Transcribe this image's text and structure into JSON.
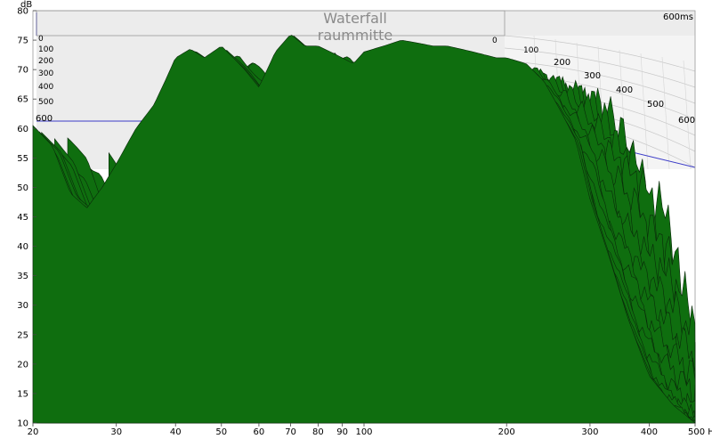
{
  "chart_data": {
    "type": "area",
    "title": "Waterfall",
    "subtitle": "raummitte",
    "ylabel": "dB",
    "xunit": "Hz",
    "xscale": "log",
    "xlim": [
      20,
      500
    ],
    "ylim": [
      10,
      80
    ],
    "x_ticks": [
      "20",
      "30",
      "40",
      "50",
      "60",
      "70",
      "80",
      "90",
      "100",
      "200",
      "300",
      "400",
      "500 Hz"
    ],
    "y_ticks": [
      "10",
      "15",
      "20",
      "25",
      "30",
      "35",
      "40",
      "45",
      "50",
      "55",
      "60",
      "65",
      "70",
      "75",
      "80"
    ],
    "time_axis_label": "600ms",
    "time_ticks_left": [
      "0",
      "100",
      "200",
      "300",
      "400",
      "500",
      "600"
    ],
    "time_ticks_right": [
      "0",
      "100",
      "200",
      "300",
      "400",
      "500",
      "600"
    ],
    "grid": true,
    "front_slice": {
      "time_ms": 0,
      "x": [
        20,
        22,
        24,
        26,
        28,
        30,
        33,
        36,
        38,
        40,
        43,
        46,
        50,
        53,
        56,
        60,
        65,
        70,
        75,
        80,
        85,
        90,
        95,
        100,
        110,
        120,
        130,
        140,
        150,
        160,
        170,
        180,
        190,
        200,
        220,
        240,
        260,
        280,
        300,
        330,
        360,
        400,
        450,
        500
      ],
      "y": [
        60.5,
        57,
        49,
        46.5,
        50,
        54,
        60,
        64,
        68,
        72,
        73.5,
        72,
        74,
        72,
        70,
        67,
        73,
        76,
        74,
        74,
        73,
        72,
        71,
        73,
        74,
        75,
        74.5,
        74,
        74,
        73.5,
        73,
        72.5,
        72,
        72,
        71,
        68,
        63,
        58,
        48,
        38,
        28,
        18,
        13,
        10
      ]
    },
    "series_color": "#0f6e0f"
  }
}
